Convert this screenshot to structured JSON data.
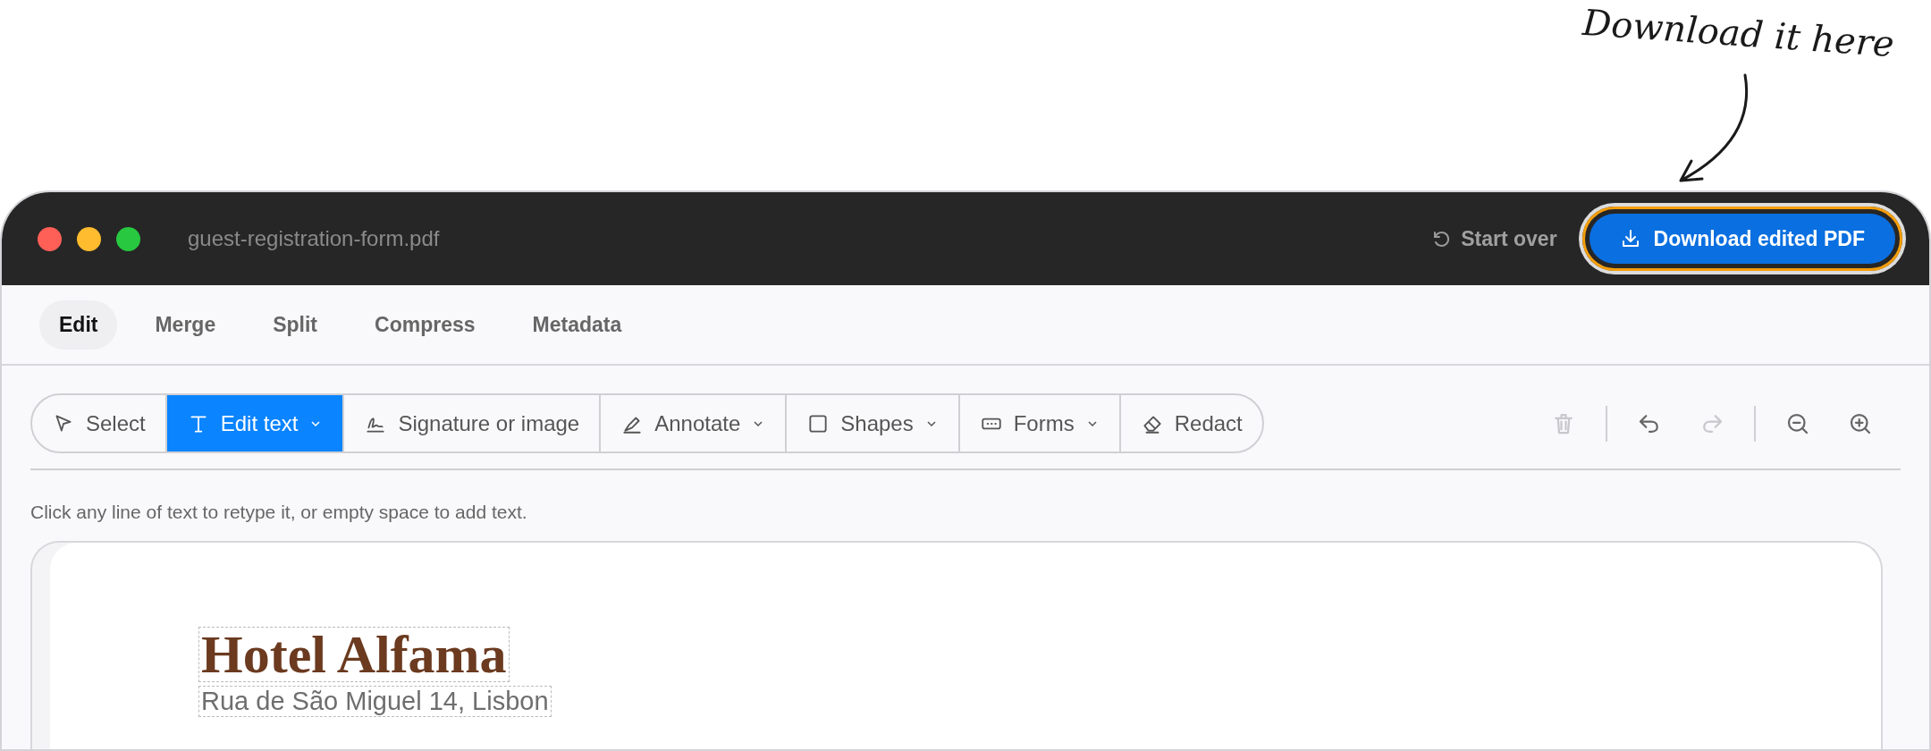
{
  "annotation": {
    "text": "Download it here"
  },
  "window": {
    "title": "guest-registration-form.pdf"
  },
  "header": {
    "start_over": "Start over",
    "download": {
      "label": "Download edited PDF",
      "highlighted": true
    }
  },
  "tabs": [
    {
      "label": "Edit",
      "selected": true
    },
    {
      "label": "Merge",
      "selected": false
    },
    {
      "label": "Split",
      "selected": false
    },
    {
      "label": "Compress",
      "selected": false
    },
    {
      "label": "Metadata",
      "selected": false
    }
  ],
  "tools": [
    {
      "kind": "select",
      "label": "Select",
      "selected": false,
      "dropdown": false
    },
    {
      "kind": "text",
      "label": "Edit text",
      "selected": true,
      "dropdown": true
    },
    {
      "kind": "signature",
      "label": "Signature or image",
      "selected": false,
      "dropdown": false
    },
    {
      "kind": "annotate",
      "label": "Annotate",
      "selected": false,
      "dropdown": true
    },
    {
      "kind": "shapes",
      "label": "Shapes",
      "selected": false,
      "dropdown": true
    },
    {
      "kind": "forms",
      "label": "Forms",
      "selected": false,
      "dropdown": true
    },
    {
      "kind": "redact",
      "label": "Redact",
      "selected": false,
      "dropdown": false
    }
  ],
  "actions": [
    {
      "kind": "delete",
      "disabled": true
    },
    {
      "kind": "undo",
      "disabled": false
    },
    {
      "kind": "redo",
      "disabled": true
    },
    {
      "kind": "zoom-out",
      "disabled": false
    },
    {
      "kind": "zoom-in",
      "disabled": false
    }
  ],
  "hint": "Click any line of text to retype it, or empty space to add text.",
  "document": {
    "title": "Hotel Alfama",
    "address": "Rua de São Miguel 14, Lisbon"
  }
}
